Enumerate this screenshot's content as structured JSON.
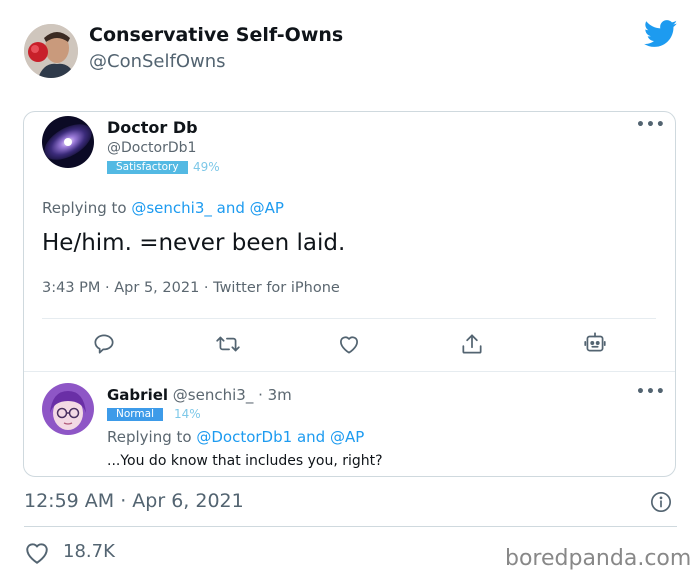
{
  "author": {
    "name": "Conservative Self-Owns",
    "handle": "@ConSelfOwns"
  },
  "quoted_tweet": {
    "name": "Doctor Db",
    "handle": "@DoctorDb1",
    "badge": "Satisfactory",
    "percent": "49%",
    "replying_prefix": "Replying to ",
    "replying_user1": "@senchi3_",
    "replying_and": " and ",
    "replying_user2": "@AP",
    "text": "He/him. =never been laid.",
    "meta": "3:43 PM · Apr 5, 2021 · Twitter for iPhone",
    "more": "•••"
  },
  "reply": {
    "name": "Gabriel",
    "handle_time": " @senchi3_ · 3m",
    "badge": "Normal",
    "percent": "14%",
    "replying_prefix": "Replying to ",
    "replying_user1": "@DoctorDb1",
    "replying_and": " and ",
    "replying_user2": "@AP",
    "text": "...You do know that includes you, right?",
    "more": "•••"
  },
  "timestamp": "12:59 AM · Apr 6, 2021",
  "likes": "18.7K",
  "watermark": "boredpanda.com",
  "colors": {
    "link": "#1d9bf0",
    "satisfactory_badge": "#53b9e3",
    "normal_badge": "#3d9be9",
    "secondary_text": "#536471"
  },
  "icons": [
    "twitter-bird-icon",
    "reply-icon",
    "retweet-icon",
    "like-icon",
    "share-icon",
    "robot-icon",
    "info-icon",
    "heart-icon"
  ]
}
